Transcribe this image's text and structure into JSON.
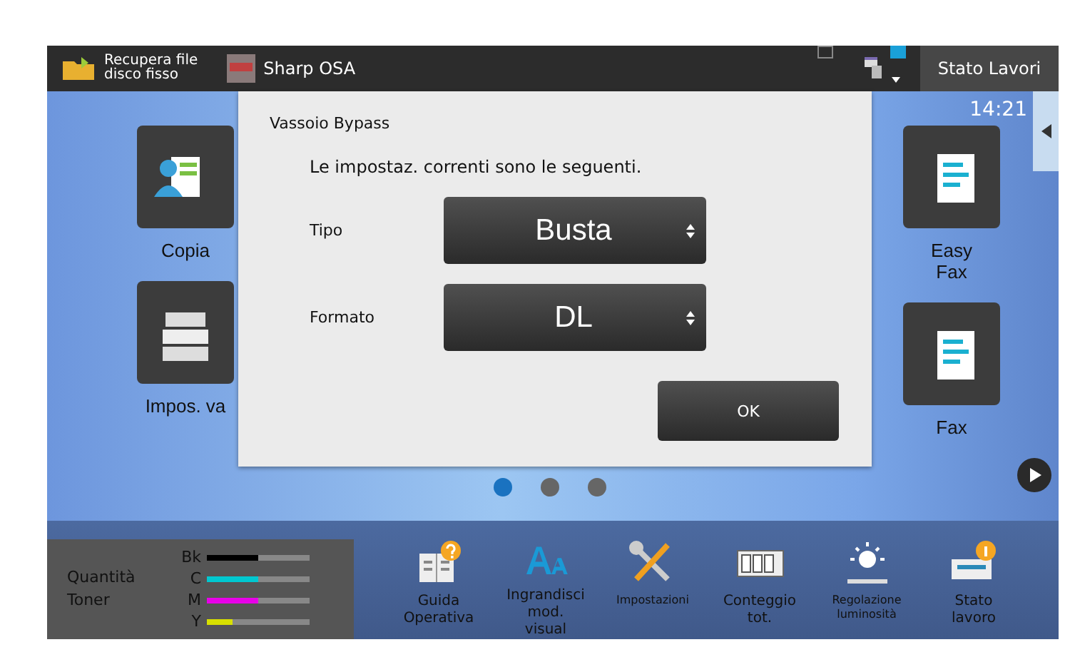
{
  "top_bar": {
    "hdd_button": "Recupera file\ndisco fisso",
    "app_button": "Sharp OSA",
    "indicators": [
      {
        "on": false
      },
      {
        "on": true
      }
    ],
    "status_button": "Stato Lavori"
  },
  "clock": "14:21",
  "home_tiles_left": [
    {
      "label": "Copia",
      "kind": "copy"
    },
    {
      "label": "Impos. va",
      "kind": "printer"
    }
  ],
  "home_tiles_right": [
    {
      "label": "Easy\nFax",
      "kind": "doc"
    },
    {
      "label": "Fax",
      "kind": "doc"
    }
  ],
  "pages": [
    {
      "selected": true
    },
    {
      "selected": false
    },
    {
      "selected": false
    }
  ],
  "dialog": {
    "title": "Vassoio Bypass",
    "message": "Le impostaz. correnti sono le seguenti.",
    "fields": [
      {
        "label": "Tipo",
        "value": "Busta"
      },
      {
        "label": "Formato",
        "value": "DL"
      }
    ],
    "ok_button": "OK"
  },
  "toner": {
    "label": "Quantità\nToner",
    "levels": [
      {
        "name": "Bk",
        "color": "#000000",
        "level": 0.5
      },
      {
        "name": "C",
        "color": "#00c8d0",
        "level": 0.5
      },
      {
        "name": "M",
        "color": "#e800e8",
        "level": 0.5
      },
      {
        "name": "Y",
        "color": "#d8e000",
        "level": 0.25
      }
    ]
  },
  "shortcuts": [
    {
      "label": "Guida\nOperativa",
      "kind": "guide"
    },
    {
      "label": "Ingrandisci\nmod.\nvisual",
      "kind": "zoom"
    },
    {
      "label": "Impostazioni",
      "kind": "tools"
    },
    {
      "label": "Conteggio\ntot.",
      "kind": "counter"
    },
    {
      "label": "Regolazione\nluminosità",
      "kind": "brightness"
    },
    {
      "label": "Stato\nlavoro",
      "kind": "status"
    }
  ]
}
